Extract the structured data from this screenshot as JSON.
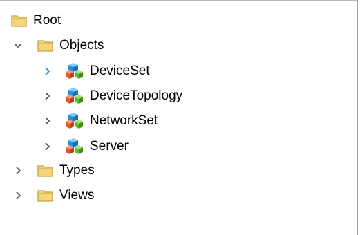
{
  "tree": {
    "root": {
      "label": "Root",
      "icon": "folder-icon"
    },
    "objects": {
      "label": "Objects",
      "icon": "folder-icon",
      "expanded": true
    },
    "children": [
      {
        "label": "DeviceSet",
        "icon": "object-cubes-icon",
        "hover": true
      },
      {
        "label": "DeviceTopology",
        "icon": "object-cubes-icon"
      },
      {
        "label": "NetworkSet",
        "icon": "object-cubes-icon"
      },
      {
        "label": "Server",
        "icon": "object-cubes-icon"
      }
    ],
    "types": {
      "label": "Types",
      "icon": "folder-icon"
    },
    "views": {
      "label": "Views",
      "icon": "folder-icon"
    }
  },
  "colors": {
    "folder_fill": "#F4D67A",
    "folder_stroke": "#C8A046",
    "chevron": "#555555",
    "chevron_hover": "#1E90E0"
  }
}
